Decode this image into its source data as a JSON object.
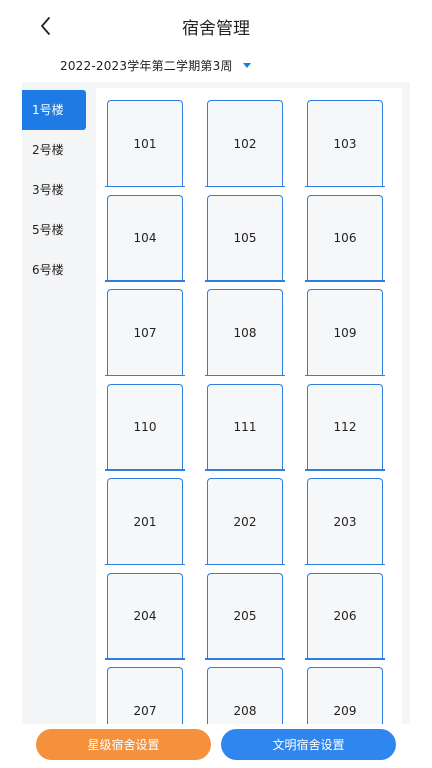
{
  "header": {
    "title": "宿舍管理",
    "back_icon": "chevron-left-icon"
  },
  "term": {
    "label": "2022-2023学年第二学期第3周",
    "dropdown_icon": "caret-down-icon",
    "accent": "#1e7be6"
  },
  "sidebar": {
    "items": [
      {
        "label": "1号楼",
        "active": true
      },
      {
        "label": "2号楼",
        "active": false
      },
      {
        "label": "3号楼",
        "active": false
      },
      {
        "label": "5号楼",
        "active": false
      },
      {
        "label": "6号楼",
        "active": false
      }
    ]
  },
  "rooms": [
    "101",
    "102",
    "103",
    "104",
    "105",
    "106",
    "107",
    "108",
    "109",
    "110",
    "111",
    "112",
    "201",
    "202",
    "203",
    "204",
    "205",
    "206",
    "207",
    "208",
    "209"
  ],
  "footer": {
    "star_button": "星级宿舍设置",
    "civil_button": "文明宿舍设置",
    "star_color": "#f5913c",
    "civil_color": "#2f86ee"
  }
}
